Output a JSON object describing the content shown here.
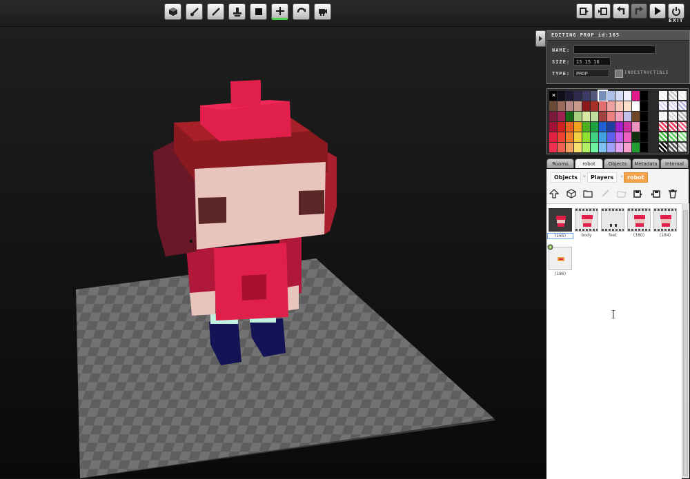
{
  "toolbar": {
    "left_tools": [
      {
        "name": "scene-tool",
        "icon": "cube-icon"
      },
      {
        "name": "paint-tool",
        "icon": "brush-icon"
      },
      {
        "name": "line-tool",
        "icon": "pencil-icon"
      },
      {
        "name": "stamp-tool",
        "icon": "stamp-icon"
      },
      {
        "name": "block-tool",
        "icon": "square-icon"
      },
      {
        "name": "add-tool",
        "icon": "plus-icon",
        "active": true
      },
      {
        "name": "rotate-tool",
        "icon": "rotate-icon"
      },
      {
        "name": "camera-tool",
        "icon": "camera-icon"
      }
    ],
    "right_tools": [
      {
        "name": "export-button",
        "icon": "export-icon"
      },
      {
        "name": "import-button",
        "icon": "import-icon"
      },
      {
        "name": "undo-button",
        "icon": "undo-icon"
      },
      {
        "name": "redo-button",
        "icon": "redo-icon",
        "disabled": true
      },
      {
        "name": "play-button",
        "icon": "play-icon"
      },
      {
        "name": "exit-button",
        "icon": "exit-icon"
      }
    ],
    "exit_label": "EXIT"
  },
  "prop_panel": {
    "title": "EDITING PROP id:165",
    "name_label": "NAME:",
    "name_value": "",
    "size_label": "SIZE:",
    "size_value": "15 15 16",
    "type_label": "TYPE:",
    "type_value": "PROP",
    "indestructible_label": "INDESTRUCTIBLE",
    "indestructible_checked": false
  },
  "palette": {
    "rows": [
      [
        "#000000",
        "#120d1a",
        "#1f1a33",
        "#2e2a4d",
        "#3d3a66",
        "#54587a",
        "#7a8fb8",
        "#aec0e8",
        "#d2dcf5",
        "#f0f0ff",
        "#e0188a",
        "#000000"
      ],
      [
        "#6a4a35",
        "#9a6a5a",
        "#b88a8a",
        "#c89a8a",
        "#8a1a1a",
        "#a8302a",
        "#e07070",
        "#f0a0a0",
        "#f8c8b8",
        "#fce0c8",
        "#ffffff",
        "#000000"
      ],
      [
        "#7a1a3a",
        "#a02050",
        "#1a6a1a",
        "#a8d080",
        "#d8e8a0",
        "#c0e0a0",
        "#a04040",
        "#f08080",
        "#f0a0b8",
        "#c0c0e8",
        "#704828",
        "#000000"
      ],
      [
        "#a01030",
        "#d02020",
        "#e86020",
        "#f0a020",
        "#50b020",
        "#20a040",
        "#2060d0",
        "#2040a0",
        "#a020d0",
        "#d030a0",
        "#f090c0",
        "#000000"
      ],
      [
        "#e02040",
        "#f04030",
        "#f08030",
        "#f0d040",
        "#90e030",
        "#40d080",
        "#40a0e0",
        "#6060f0",
        "#c060f0",
        "#f060c0",
        "#103010",
        "#000000"
      ],
      [
        "#f03050",
        "#f06050",
        "#f0a060",
        "#f8e070",
        "#b0f060",
        "#70f0a0",
        "#80c0f0",
        "#a0a0f8",
        "#e0a0f0",
        "#f8a0d0",
        "#20a030",
        "#000000"
      ]
    ],
    "right_cells": [
      [
        "#f0f0f0",
        "#c8c8c8",
        "#f0f0f0"
      ],
      [
        "#d8d8f0",
        "#d8d8f0",
        "#b8b8e0"
      ],
      [
        "#f0f0f0",
        "#d8d8d8",
        "#b8b8b8"
      ],
      [
        "#f04060",
        "#f04060",
        "#f06080"
      ],
      [
        "#40c040",
        "#60d060",
        "#80e080"
      ],
      [
        "#000000",
        "#555555",
        "#aaaaaa"
      ]
    ],
    "selected_color": "#7a8fb8"
  },
  "tabs": [
    {
      "label": "Rooms",
      "active": false
    },
    {
      "label": "robot",
      "active": true
    },
    {
      "label": "Objects",
      "active": false
    },
    {
      "label": "Metadata",
      "active": false
    },
    {
      "label": "Internal",
      "active": false
    }
  ],
  "breadcrumbs": {
    "items": [
      "Objects",
      "Players",
      "robot"
    ],
    "separator": ">"
  },
  "browser_tools": [
    {
      "name": "up-button",
      "icon": "up-arrow-icon"
    },
    {
      "name": "new-object-button",
      "icon": "cube-outline-icon"
    },
    {
      "name": "new-folder-button",
      "icon": "folder-icon"
    },
    {
      "name": "rename-button",
      "icon": "pencil-icon",
      "disabled": true
    },
    {
      "name": "open-button",
      "icon": "open-folder-icon",
      "disabled": true
    },
    {
      "name": "save-button",
      "icon": "save-arrow-icon"
    },
    {
      "name": "load-button",
      "icon": "load-icon"
    },
    {
      "name": "delete-button",
      "icon": "trash-icon"
    }
  ],
  "items": [
    {
      "label": "(165)",
      "selected": true
    },
    {
      "label": "body",
      "selected": false
    },
    {
      "label": "feet",
      "selected": false
    },
    {
      "label": "(180)",
      "selected": false
    },
    {
      "label": "(184)",
      "selected": false
    },
    {
      "label": "(186)",
      "selected": false
    }
  ],
  "colors": {
    "robot_red": "#e0204a",
    "robot_dark_red": "#8a1a20",
    "face": "#e8c4bc",
    "eyes": "#5a2626",
    "legs": "#10104a",
    "floor_light": "#727272",
    "floor_dark": "#5c5c5c",
    "accent_orange": "#f5a34a"
  }
}
